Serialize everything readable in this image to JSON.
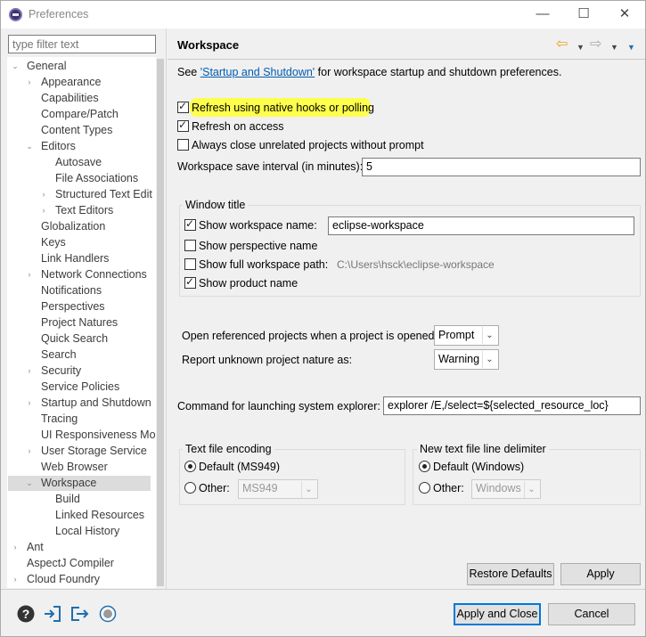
{
  "window": {
    "title": "Preferences",
    "controls": [
      "—",
      "☐",
      "✕"
    ]
  },
  "filter": {
    "placeholder": "type filter text"
  },
  "tree": [
    {
      "label": "General",
      "expanded": true
    },
    {
      "label": "Appearance"
    },
    {
      "label": "Capabilities"
    },
    {
      "label": "Compare/Patch"
    },
    {
      "label": "Content Types"
    },
    {
      "label": "Editors",
      "expanded": true
    },
    {
      "label": "Autosave"
    },
    {
      "label": "File Associations"
    },
    {
      "label": "Structured Text Edit"
    },
    {
      "label": "Text Editors"
    },
    {
      "label": "Globalization"
    },
    {
      "label": "Keys"
    },
    {
      "label": "Link Handlers"
    },
    {
      "label": "Network Connections"
    },
    {
      "label": "Notifications"
    },
    {
      "label": "Perspectives"
    },
    {
      "label": "Project Natures"
    },
    {
      "label": "Quick Search"
    },
    {
      "label": "Search"
    },
    {
      "label": "Security"
    },
    {
      "label": "Service Policies"
    },
    {
      "label": "Startup and Shutdown"
    },
    {
      "label": "Tracing"
    },
    {
      "label": "UI Responsiveness Mor"
    },
    {
      "label": "User Storage Service"
    },
    {
      "label": "Web Browser"
    },
    {
      "label": "Workspace",
      "expanded": true,
      "selected": true
    },
    {
      "label": "Build"
    },
    {
      "label": "Linked Resources"
    },
    {
      "label": "Local History"
    },
    {
      "label": "Ant"
    },
    {
      "label": "AspectJ Compiler"
    },
    {
      "label": "Cloud Foundry"
    }
  ],
  "page": {
    "title": "Workspace",
    "intro_prefix": "See ",
    "intro_link": "'Startup and Shutdown'",
    "intro_suffix": " for workspace startup and shutdown preferences.",
    "refresh_native_label": "Refresh using native hooks or polling",
    "refresh_access_label": "Refresh on access",
    "always_close_label": "Always close unrelated projects without prompt",
    "save_interval_label": "Workspace save interval (in minutes):",
    "save_interval_value": "5",
    "window_title_group": "Window title",
    "show_ws_name_label": "Show workspace name:",
    "ws_name_value": "eclipse-workspace",
    "show_perspective_label": "Show perspective name",
    "show_full_path_label": "Show full workspace path:",
    "full_path_value": "C:\\Users\\hsck\\eclipse-workspace",
    "show_product_label": "Show product name",
    "open_ref_label": "Open referenced projects when a project is opened:",
    "open_ref_value": "Prompt",
    "report_unknown_label": "Report unknown project nature as:",
    "report_unknown_value": "Warning",
    "command_label": "Command for launching system explorer:",
    "command_value": "explorer /E,/select=${selected_resource_loc}",
    "encoding_group": "Text file encoding",
    "encoding_default_label": "Default (MS949)",
    "encoding_other_label": "Other:",
    "encoding_other_value": "MS949",
    "delimiter_group": "New text file line delimiter",
    "delimiter_default_label": "Default (Windows)",
    "delimiter_other_label": "Other:",
    "delimiter_other_value": "Windows",
    "restore_defaults": "Restore Defaults",
    "apply": "Apply"
  },
  "footer": {
    "apply_close": "Apply and Close",
    "cancel": "Cancel"
  },
  "colors": {
    "highlight": "#ffff3a",
    "link": "#005cb3",
    "nav_arrow": "#f0a020",
    "icon_blue": "#1e6fb0"
  }
}
